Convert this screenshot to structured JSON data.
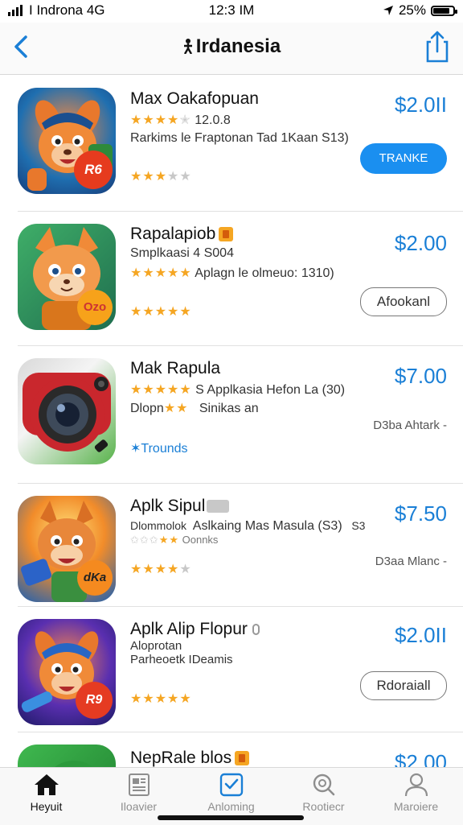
{
  "status_bar": {
    "carrier": "I Indrona 4G",
    "time": "12:3 IM",
    "battery": "25%",
    "battery_level": 0.85
  },
  "nav": {
    "title": "Irdanesia"
  },
  "apps": [
    {
      "name": "Max Oakafopuan",
      "rating_text": "12.0.8",
      "line2": "Rarkims le Fraptonan Tad 1Kaan S13)",
      "price": "$2.0II",
      "button": "TRANKE",
      "button_style": "filled",
      "icon_label": "R6",
      "icon_bg": "#1f6fb0"
    },
    {
      "name": "Rapalapiob",
      "line1": "Smplkaasi 4 S004",
      "line2": "Aplagn le olmeuo: 1310)",
      "price": "$2.00",
      "button": "Afookanl",
      "button_style": "outline",
      "icon_label": "Ozo",
      "icon_bg": "#2f8f4f"
    },
    {
      "name": "Mak Rapula",
      "line1": "S Applkasia Hefon La (30)",
      "line2_a": "Dlopn",
      "line2_b": "Sinikas an",
      "sub": "Trounds",
      "link": "D3ba Ahtark -",
      "price": "$7.00",
      "icon_bg": "#3fae52"
    },
    {
      "name": "Aplk Sipul",
      "line1_a": "Dlommolok",
      "line1_b": "Aslkaing Mas Masula (S3)",
      "line1_c": "S3",
      "line2": "Oonnks",
      "link": "D3aa Mlanc -",
      "price": "$7.50",
      "icon_label": "dKa",
      "icon_bg": "#2a7fd4"
    },
    {
      "name": "Aplk Alip Flopur",
      "line1": "Aloprotan",
      "line2": "Parheoetk  IDeamis",
      "price": "$2.0II",
      "button": "Rdoraiall",
      "button_style": "outline",
      "icon_label": "R9",
      "icon_bg": "#3b2d9a"
    },
    {
      "name": "NepRale blos",
      "price": "$2.00",
      "icon_bg": "#2c9a3c"
    }
  ],
  "tabs": [
    {
      "label": "Heyuit",
      "icon": "home-icon",
      "active": true
    },
    {
      "label": "Iloavier",
      "icon": "news-icon",
      "active": false
    },
    {
      "label": "Anloming",
      "icon": "apps-icon",
      "active": false
    },
    {
      "label": "Rootiecr",
      "icon": "search-icon",
      "active": false
    },
    {
      "label": "Maroiere",
      "icon": "person-icon",
      "active": false
    }
  ],
  "colors": {
    "accent": "#1a7fd6",
    "star": "#f5a623",
    "button_blue": "#1a8ff0"
  }
}
